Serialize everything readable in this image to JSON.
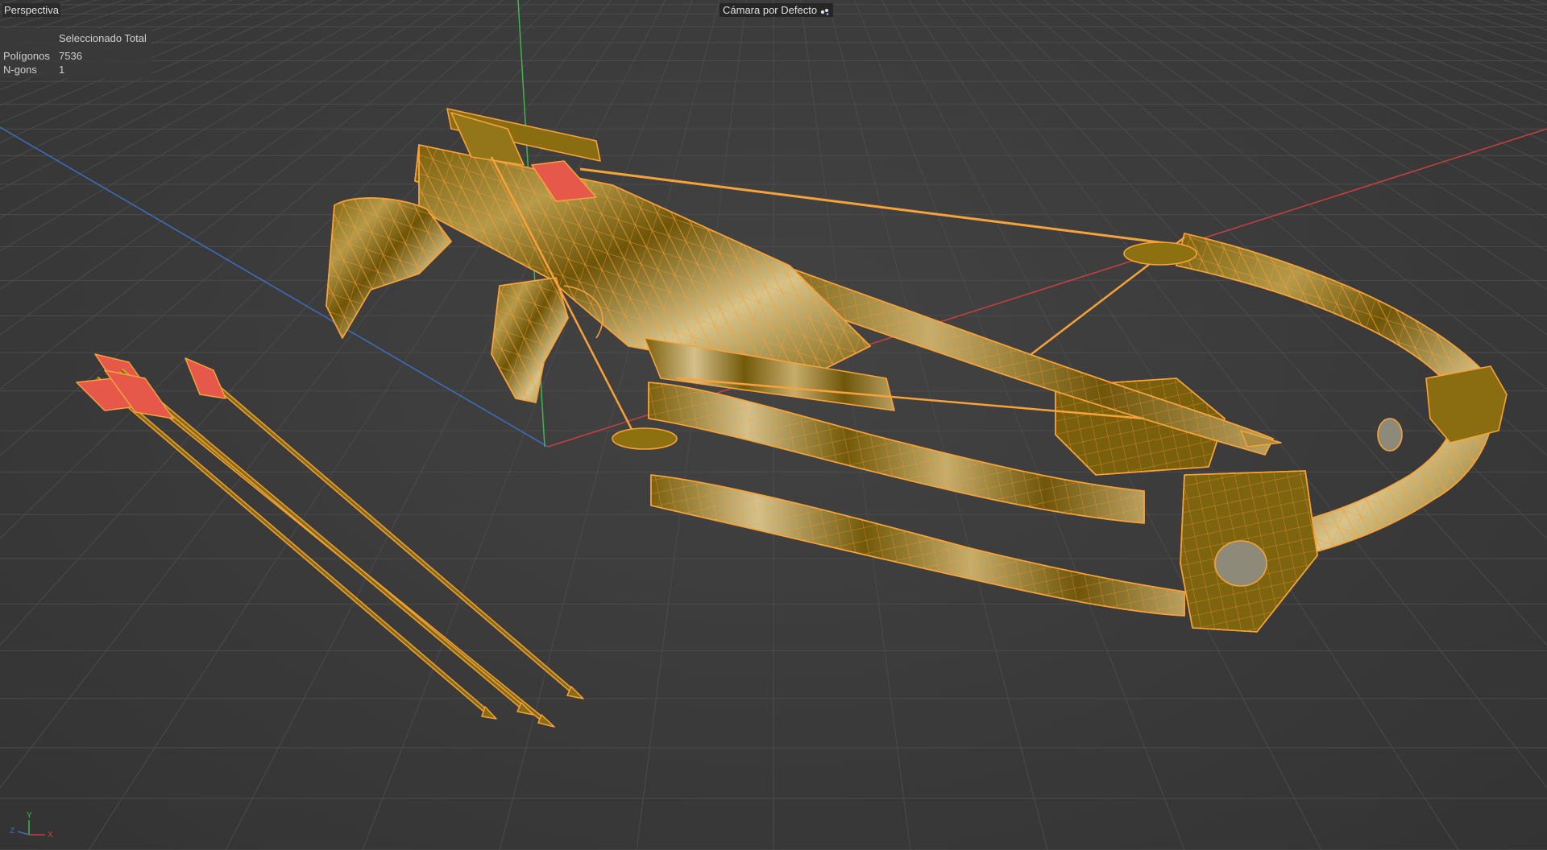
{
  "viewport": {
    "view_name": "Perspectiva",
    "camera": "Cámara por Defecto",
    "camera_icon": "camera-icon"
  },
  "stats": {
    "column_header": "Seleccionado Total",
    "rows": [
      {
        "label": "Polígonos",
        "value": "7536"
      },
      {
        "label": "N-gons",
        "value": "1"
      }
    ]
  },
  "axis_gizmo": {
    "x": "X",
    "y": "Y",
    "z": "Z"
  },
  "colors": {
    "background": "#3b3b3b",
    "grid": "#4a4a4a",
    "wire": "#f39a2a",
    "body": "#8a6d10",
    "fletching": "#e5584a",
    "axis_x": "#c84040",
    "axis_y": "#3fb64f",
    "axis_z": "#3d6fc0"
  }
}
